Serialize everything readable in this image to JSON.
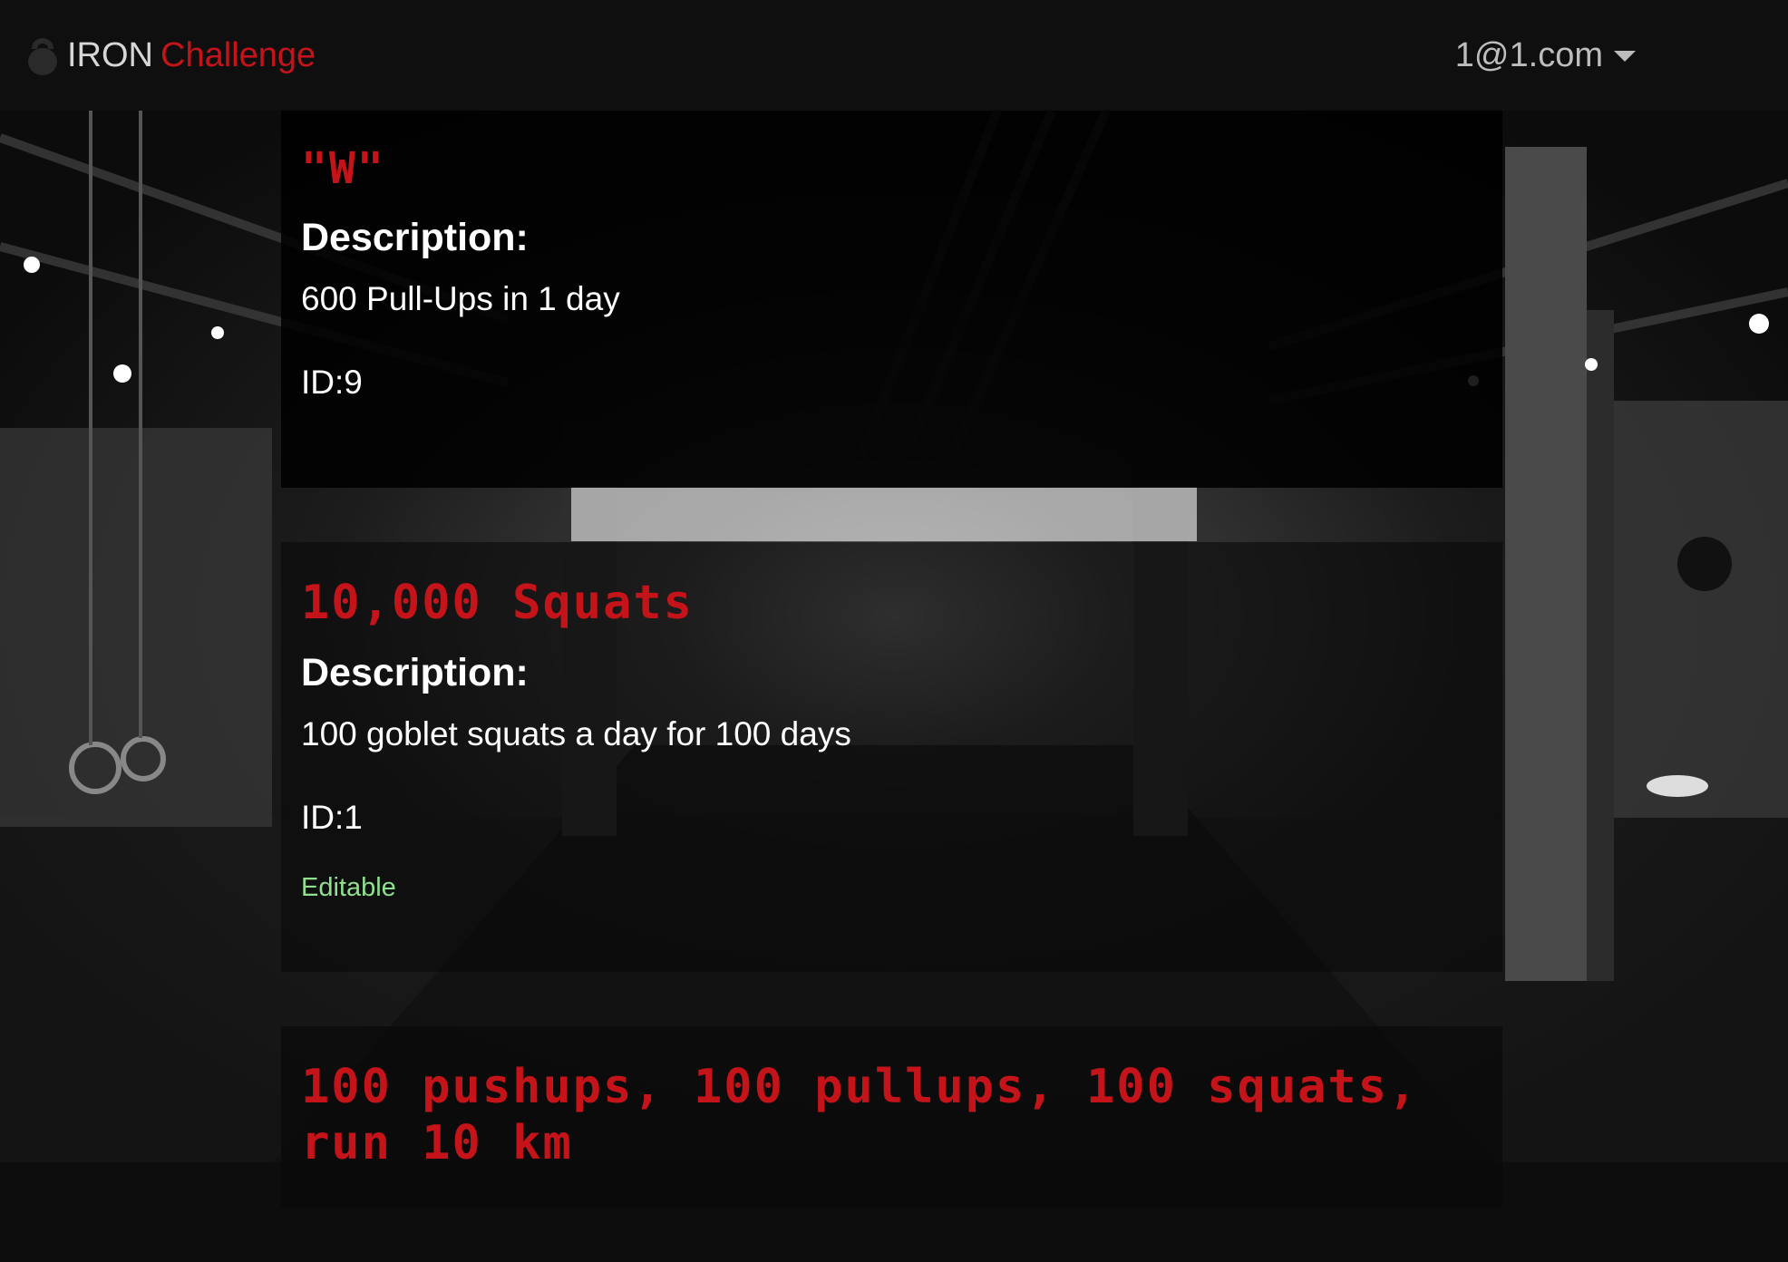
{
  "navbar": {
    "brand_icon": "kettlebell-icon",
    "brand_part1": "IRON",
    "brand_part2": "Challenge",
    "user_email": "1@1.com",
    "user_menu_icon": "caret-down-icon"
  },
  "colors": {
    "accent": "#c4141a",
    "editable": "#8fe08f",
    "navbar_bg": "#0f0f0f"
  },
  "challenges": [
    {
      "title": "\"W\"",
      "description_heading": "Description:",
      "description": "600 Pull-Ups in 1 day",
      "id": "ID:9"
    },
    {
      "title": "10,000 Squats",
      "description_heading": "Description:",
      "description": "100 goblet squats a day for 100 days",
      "id": "ID:1",
      "editable_label": "Editable"
    },
    {
      "title": "100 pushups, 100 pullups, 100 squats, run 10 km"
    }
  ]
}
